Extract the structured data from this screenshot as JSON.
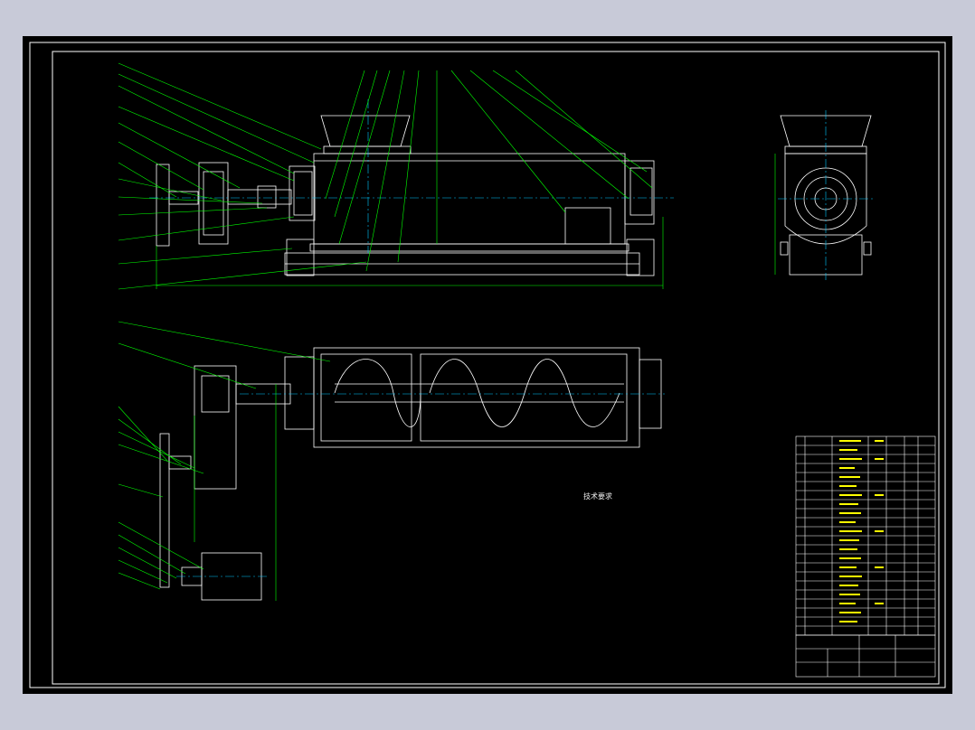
{
  "drawing": {
    "technical_requirements": {
      "title": "技术要求",
      "items": [
        "",
        "",
        "",
        "",
        "",
        "",
        "",
        "",
        "",
        "",
        "",
        "",
        ""
      ]
    },
    "title_block": {
      "name": "",
      "sheet": ""
    },
    "colors": {
      "background": "#000000",
      "outline": "#ffffff",
      "leader": "#00ff00",
      "centerline": "#00c8ff",
      "text_yellow": "#ffff00",
      "frame_outer": "#c8cad8"
    }
  }
}
